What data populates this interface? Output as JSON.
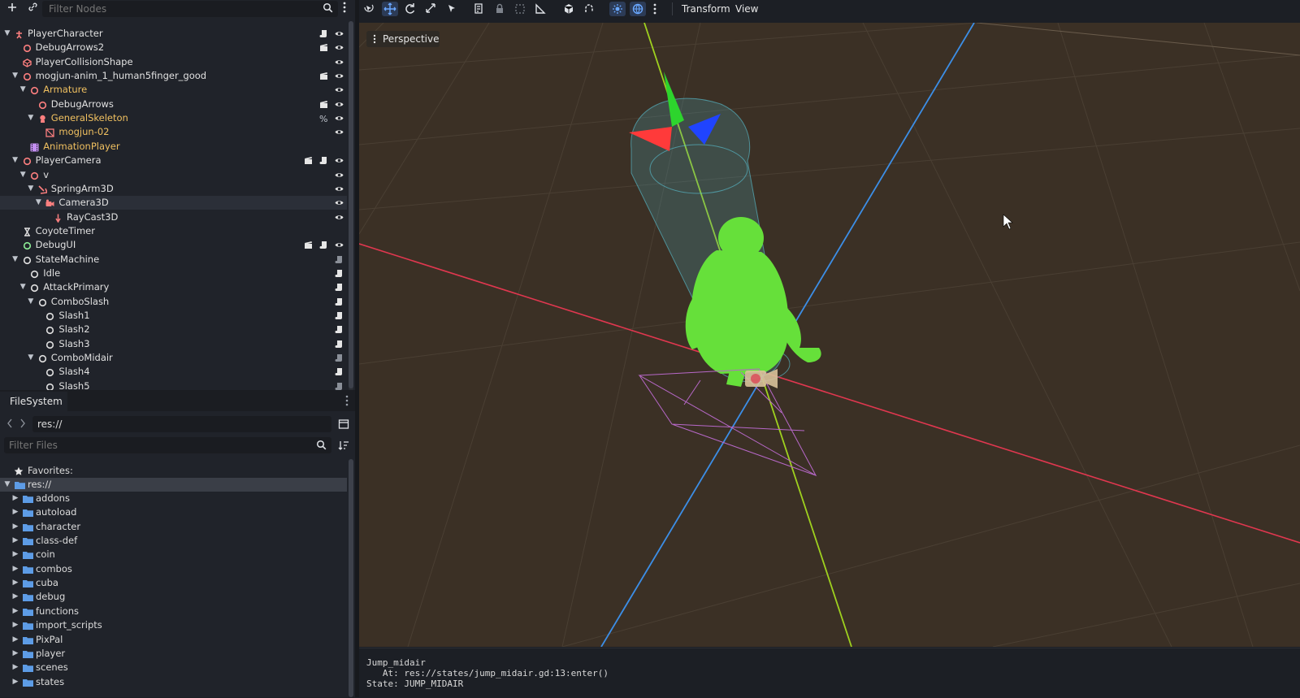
{
  "scene_dock": {
    "filter_placeholder": "Filter Nodes",
    "nodes": [
      {
        "label": "PlayerCharacter",
        "depth": 0,
        "arrow": "down",
        "icon": "character-body-icon",
        "icon_color": "#fc7f7f",
        "label_color": "#e0e0e0",
        "flags": [
          "script-icon",
          "visibility-icon"
        ]
      },
      {
        "label": "DebugArrows2",
        "depth": 1,
        "arrow": "none",
        "icon": "node3d-icon",
        "icon_color": "#fc7f7f",
        "label_color": "#e0e0e0",
        "flags": [
          "clapper-icon",
          "visibility-icon"
        ]
      },
      {
        "label": "PlayerCollisionShape",
        "depth": 1,
        "arrow": "none",
        "icon": "collision-shape-icon",
        "icon_color": "#fc7f7f",
        "label_color": "#e0e0e0",
        "flags": [
          "visibility-icon"
        ]
      },
      {
        "label": "mogjun-anim_1_human5finger_good",
        "depth": 1,
        "arrow": "down",
        "icon": "node3d-icon",
        "icon_color": "#fc7f7f",
        "label_color": "#e0e0e0",
        "flags": [
          "clapper-icon",
          "visibility-icon"
        ]
      },
      {
        "label": "Armature",
        "depth": 2,
        "arrow": "down",
        "icon": "node3d-icon",
        "icon_color": "#fc7f7f",
        "label_color": "#f0c060",
        "flags": [
          "visibility-icon"
        ]
      },
      {
        "label": "DebugArrows",
        "depth": 3,
        "arrow": "none",
        "icon": "node3d-icon",
        "icon_color": "#fc7f7f",
        "label_color": "#e0e0e0",
        "flags": [
          "clapper-icon",
          "visibility-icon"
        ]
      },
      {
        "label": "GeneralSkeleton",
        "depth": 3,
        "arrow": "down",
        "icon": "skeleton-icon",
        "icon_color": "#fc7f7f",
        "label_color": "#f0c060",
        "flags": [
          "percent-icon",
          "visibility-icon"
        ]
      },
      {
        "label": "mogjun-02",
        "depth": 4,
        "arrow": "none",
        "icon": "mesh-instance-icon",
        "icon_color": "#fc7f7f",
        "label_color": "#f0c060",
        "flags": [
          "visibility-icon"
        ]
      },
      {
        "label": "AnimationPlayer",
        "depth": 2,
        "arrow": "none",
        "icon": "animation-player-icon",
        "icon_color": "#c38ef1",
        "label_color": "#f0c060",
        "flags": []
      },
      {
        "label": "PlayerCamera",
        "depth": 1,
        "arrow": "down",
        "icon": "node3d-icon",
        "icon_color": "#fc7f7f",
        "label_color": "#e0e0e0",
        "flags": [
          "clapper-icon",
          "script-icon",
          "visibility-icon"
        ]
      },
      {
        "label": "v",
        "depth": 2,
        "arrow": "down",
        "icon": "node3d-icon",
        "icon_color": "#fc7f7f",
        "label_color": "#e0e0e0",
        "flags": [
          "visibility-icon"
        ]
      },
      {
        "label": "SpringArm3D",
        "depth": 3,
        "arrow": "down",
        "icon": "spring-arm-icon",
        "icon_color": "#fc7f7f",
        "label_color": "#e0e0e0",
        "flags": [
          "visibility-icon"
        ]
      },
      {
        "label": "Camera3D",
        "depth": 4,
        "arrow": "down",
        "icon": "camera-icon",
        "icon_color": "#fc7f7f",
        "label_color": "#e0e0e0",
        "flags": [
          "visibility-icon"
        ],
        "selected": true
      },
      {
        "label": "RayCast3D",
        "depth": 5,
        "arrow": "none",
        "icon": "raycast-icon",
        "icon_color": "#fc7f7f",
        "label_color": "#e0e0e0",
        "flags": [
          "visibility-icon"
        ]
      },
      {
        "label": "CoyoteTimer",
        "depth": 1,
        "arrow": "none",
        "icon": "timer-icon",
        "icon_color": "#e0e0e0",
        "label_color": "#e0e0e0",
        "flags": []
      },
      {
        "label": "DebugUI",
        "depth": 1,
        "arrow": "none",
        "icon": "control-icon",
        "icon_color": "#8eef97",
        "label_color": "#e0e0e0",
        "flags": [
          "clapper-icon",
          "script-icon",
          "visibility-icon"
        ]
      },
      {
        "label": "StateMachine",
        "depth": 1,
        "arrow": "down",
        "icon": "node-icon",
        "icon_color": "#e0e0e0",
        "label_color": "#e0e0e0",
        "flags": [
          "script-dim-icon"
        ]
      },
      {
        "label": "Idle",
        "depth": 2,
        "arrow": "none",
        "icon": "node-icon",
        "icon_color": "#e0e0e0",
        "label_color": "#e0e0e0",
        "flags": [
          "script-icon"
        ]
      },
      {
        "label": "AttackPrimary",
        "depth": 2,
        "arrow": "down",
        "icon": "node-icon",
        "icon_color": "#e0e0e0",
        "label_color": "#e0e0e0",
        "flags": [
          "script-icon"
        ]
      },
      {
        "label": "ComboSlash",
        "depth": 3,
        "arrow": "down",
        "icon": "node-icon",
        "icon_color": "#e0e0e0",
        "label_color": "#e0e0e0",
        "flags": [
          "script-icon"
        ]
      },
      {
        "label": "Slash1",
        "depth": 4,
        "arrow": "none",
        "icon": "node-icon",
        "icon_color": "#e0e0e0",
        "label_color": "#e0e0e0",
        "flags": [
          "script-icon"
        ]
      },
      {
        "label": "Slash2",
        "depth": 4,
        "arrow": "none",
        "icon": "node-icon",
        "icon_color": "#e0e0e0",
        "label_color": "#e0e0e0",
        "flags": [
          "script-icon"
        ]
      },
      {
        "label": "Slash3",
        "depth": 4,
        "arrow": "none",
        "icon": "node-icon",
        "icon_color": "#e0e0e0",
        "label_color": "#e0e0e0",
        "flags": [
          "script-icon"
        ]
      },
      {
        "label": "ComboMidair",
        "depth": 3,
        "arrow": "down",
        "icon": "node-icon",
        "icon_color": "#e0e0e0",
        "label_color": "#e0e0e0",
        "flags": [
          "script-dim-icon"
        ]
      },
      {
        "label": "Slash4",
        "depth": 4,
        "arrow": "none",
        "icon": "node-icon",
        "icon_color": "#e0e0e0",
        "label_color": "#e0e0e0",
        "flags": [
          "script-icon"
        ]
      },
      {
        "label": "Slash5",
        "depth": 4,
        "arrow": "none",
        "icon": "node-icon",
        "icon_color": "#e0e0e0",
        "label_color": "#e0e0e0",
        "flags": [
          "script-dim-icon"
        ]
      }
    ]
  },
  "filesystem": {
    "tab_label": "FileSystem",
    "path_value": "res://",
    "filter_placeholder": "Filter Files",
    "favorites_label": "Favorites:",
    "root_label": "res://",
    "folders": [
      "addons",
      "autoload",
      "character",
      "class-def",
      "coin",
      "combos",
      "cuba",
      "debug",
      "functions",
      "import_scripts",
      "PixPal",
      "player",
      "scenes",
      "states"
    ]
  },
  "viewport": {
    "menu_transform": "Transform",
    "menu_view": "View",
    "perspective_label": "Perspective",
    "colors": {
      "background": "#3b3025",
      "x_axis": "#e0374f",
      "y_axis": "#9fd11f",
      "z_axis": "#3c8ee6",
      "character": "#66e03a",
      "camera_frustum": "#b768c8"
    }
  },
  "output": {
    "lines": [
      "Jump_midair",
      "   At: res://states/jump_midair.gd:13:enter()",
      "State: JUMP_MIDAIR"
    ]
  }
}
